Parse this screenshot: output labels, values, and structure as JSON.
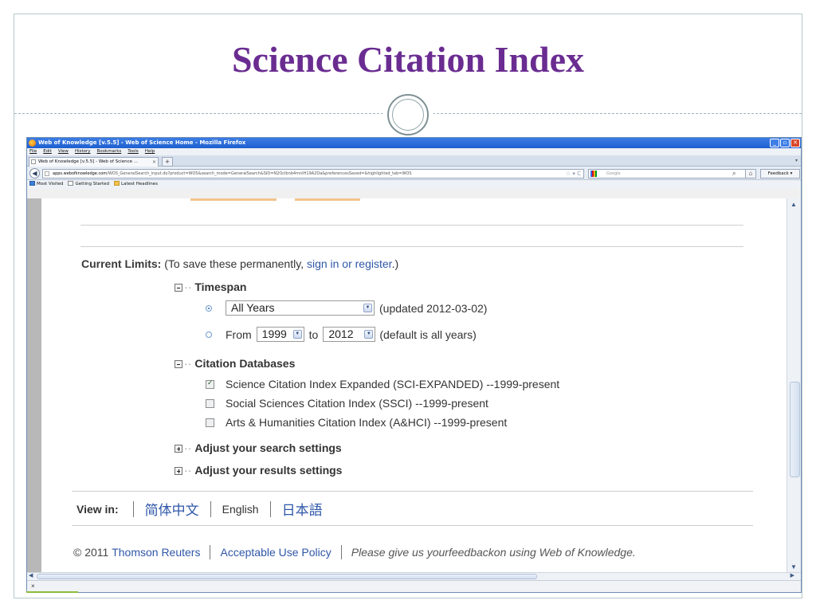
{
  "slide": {
    "title": "Science Citation Index"
  },
  "browser": {
    "window_title": "Web of Knowledge [v.5.5] - Web of Science Home - Mozilla Firefox",
    "menu": [
      "File",
      "Edit",
      "View",
      "History",
      "Bookmarks",
      "Tools",
      "Help"
    ],
    "tab_label": "Web of Knowledge [v.5.5] - Web of Science ...",
    "url_domain": "apps.webofknowledge.com",
    "url_path": "/WOS_GeneralSearch_input.do?product=WOS&search_mode=GeneralSearch&SID=N2Oclbnb4mnIH19A2Da&preferencesSaved=&highlighted_tab=WOS",
    "search_placeholder": "Google",
    "feedback_label": "Feedback",
    "bookmarks": [
      "Most Visited",
      "Getting Started",
      "Latest Headlines"
    ]
  },
  "page": {
    "limits_label": "Current Limits:",
    "limits_text_before": "(To save these permanently, ",
    "limits_link": "sign in or register",
    "limits_text_after": ".)",
    "timespan": {
      "heading": "Timespan",
      "all_years_value": "All Years",
      "updated_text": "(updated 2012-03-02)",
      "from_label": "From",
      "from_year": "1999",
      "to_label": "to",
      "to_year": "2012",
      "default_text": "(default is all years)"
    },
    "citation_databases": {
      "heading": "Citation Databases",
      "items": [
        {
          "label": "Science Citation Index Expanded (SCI-EXPANDED) --1999-present",
          "checked": true
        },
        {
          "label": "Social Sciences Citation Index (SSCI) --1999-present",
          "checked": false
        },
        {
          "label": "Arts & Humanities Citation Index (A&HCI) --1999-present",
          "checked": false
        }
      ]
    },
    "adjust_search": "Adjust your search settings",
    "adjust_results": "Adjust your results settings",
    "view_in": {
      "label": "View in:",
      "chinese": "简体中文",
      "english": "English",
      "japanese": "日本語"
    },
    "footer": {
      "copyright": "© 2011",
      "company": "Thomson Reuters",
      "policy": "Acceptable Use Policy",
      "feedback_before": "Please give us your ",
      "feedback_link": "feedback",
      "feedback_after": " on using Web of Knowledge."
    }
  },
  "colors": {
    "slide_title": "#6a2c91",
    "link": "#2f57a8",
    "titlebar": "#1e5fd0"
  }
}
